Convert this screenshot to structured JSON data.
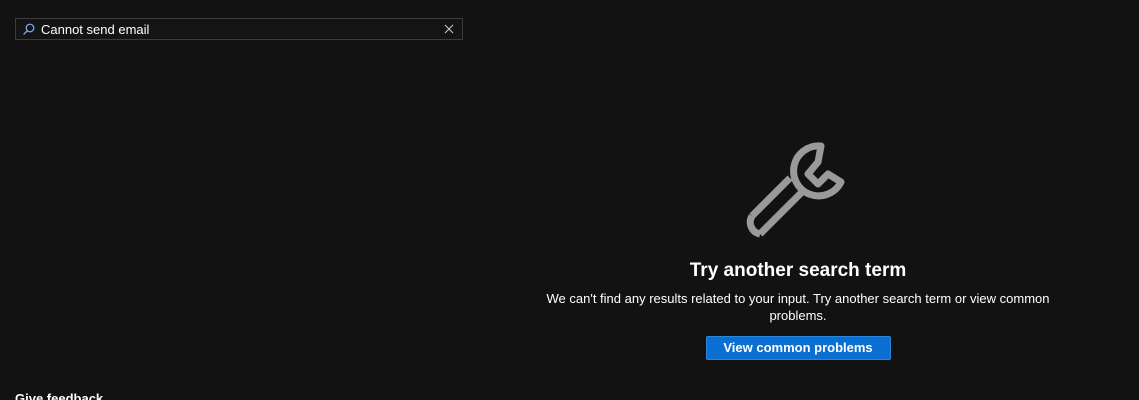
{
  "search": {
    "value": "Cannot send email",
    "icon": "search-icon",
    "clear_icon": "close-icon"
  },
  "empty_state": {
    "icon": "wrench-icon",
    "title": "Try another search term",
    "message": "We can't find any results related to your input. Try another search term or view common problems.",
    "button_label": "View common problems"
  },
  "footer": {
    "feedback_label": "Give feedback"
  },
  "colors": {
    "background": "#121212",
    "accent": "#0b6fd1",
    "icon_gray": "#9a9a9a"
  }
}
